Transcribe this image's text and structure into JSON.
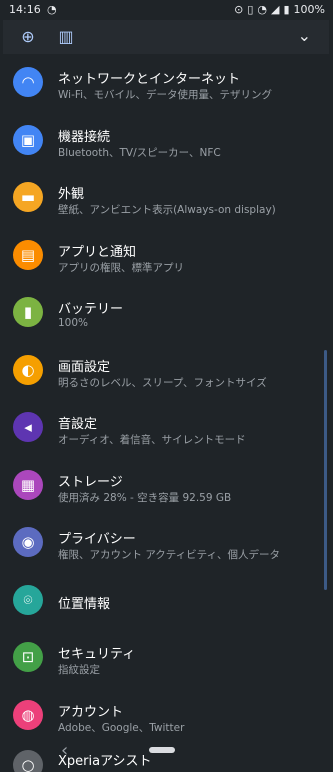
{
  "status_bar": {
    "time": "14:16",
    "battery": "100%"
  },
  "quick_settings": {
    "icons": [
      "data-saver-icon",
      "vibrate-icon"
    ],
    "expand_icon": "chevron-down-icon"
  },
  "settings": [
    {
      "title": "ネットワークとインターネット",
      "subtitle": "Wi-Fi、モバイル、データ使用量、テザリング",
      "icon": "wifi-icon",
      "color": "#4285f4"
    },
    {
      "title": "機器接続",
      "subtitle": "Bluetooth、TV/スピーカー、NFC",
      "icon": "devices-icon",
      "color": "#4285f4"
    },
    {
      "title": "外観",
      "subtitle": "壁紙、アンビエント表示(Always-on display)",
      "icon": "wallpaper-icon",
      "color": "#f5a623"
    },
    {
      "title": "アプリと通知",
      "subtitle": "アプリの権限、標準アプリ",
      "icon": "apps-icon",
      "color": "#fb8c00"
    },
    {
      "title": "バッテリー",
      "subtitle": "100%",
      "icon": "battery-icon",
      "color": "#7cb342"
    },
    {
      "title": "画面設定",
      "subtitle": "明るさのレベル、スリープ、フォントサイズ",
      "icon": "brightness-icon",
      "color": "#f59f00"
    },
    {
      "title": "音設定",
      "subtitle": "オーディオ、着信音、サイレントモード",
      "icon": "volume-icon",
      "color": "#5e35b1"
    },
    {
      "title": "ストレージ",
      "subtitle": "使用済み 28% - 空き容量 92.59 GB",
      "icon": "storage-icon",
      "color": "#ab47bc"
    },
    {
      "title": "プライバシー",
      "subtitle": "権限、アカウント アクティビティ、個人データ",
      "icon": "privacy-icon",
      "color": "#5c6bc0"
    },
    {
      "title": "位置情報",
      "subtitle": "",
      "icon": "location-icon",
      "color": "#26a69a"
    },
    {
      "title": "セキュリティ",
      "subtitle": "指紋設定",
      "icon": "lock-icon",
      "color": "#43a047"
    },
    {
      "title": "アカウント",
      "subtitle": "Adobe、Google、Twitter",
      "icon": "account-icon",
      "color": "#ec407a"
    }
  ],
  "partial_item": {
    "title": "Xperiaアシスト",
    "icon": "assist-icon"
  }
}
